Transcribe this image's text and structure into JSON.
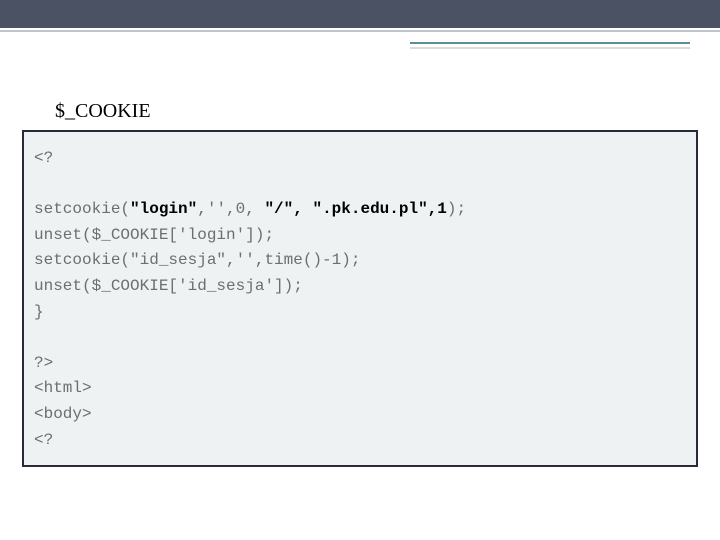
{
  "title": "$_COOKIE",
  "code": {
    "l1": "<?",
    "l2": "",
    "l3a": "setcookie(",
    "l3b": "\"login\"",
    "l3c": ",'',0, ",
    "l3d": "\"/\", \".pk.edu.pl\",1",
    "l3e": ");",
    "l4": "unset($_COOKIE['login']);",
    "l5": "setcookie(\"id_sesja\",'',time()-1);",
    "l6": "unset($_COOKIE['id_sesja']);",
    "l7": "}",
    "l8": "",
    "l9": "?>",
    "l10": "<html>",
    "l11": "<body>",
    "l12": "<?"
  }
}
